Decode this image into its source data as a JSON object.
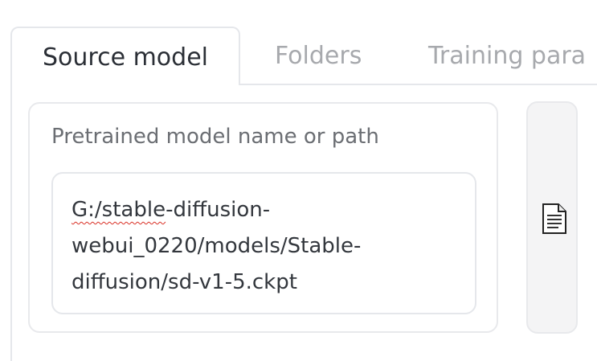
{
  "tabs": [
    {
      "label": "Source model",
      "active": true
    },
    {
      "label": "Folders",
      "active": false
    },
    {
      "label": "Training para",
      "active": false
    }
  ],
  "model_field": {
    "label": "Pretrained model name or path",
    "value": "G:/stable-diffusion-webui_0220/models/Stable-diffusion/sd-v1-5.ckpt",
    "lines": [
      {
        "underlined": "G:/stable",
        "rest": "-diffusion-"
      },
      {
        "text": "webui_0220/models/Stable-"
      },
      {
        "text": "diffusion/sd-v1-5.ckpt"
      }
    ]
  },
  "file_button": {
    "icon": "document-icon"
  },
  "colors": {
    "active_text": "#2b2f36",
    "inactive_tab_text": "#a7a9ad",
    "label_text": "#6b6e73",
    "border": "#e5e7eb",
    "button_background": "#f4f4f5",
    "spellcheck": "#d93025"
  }
}
